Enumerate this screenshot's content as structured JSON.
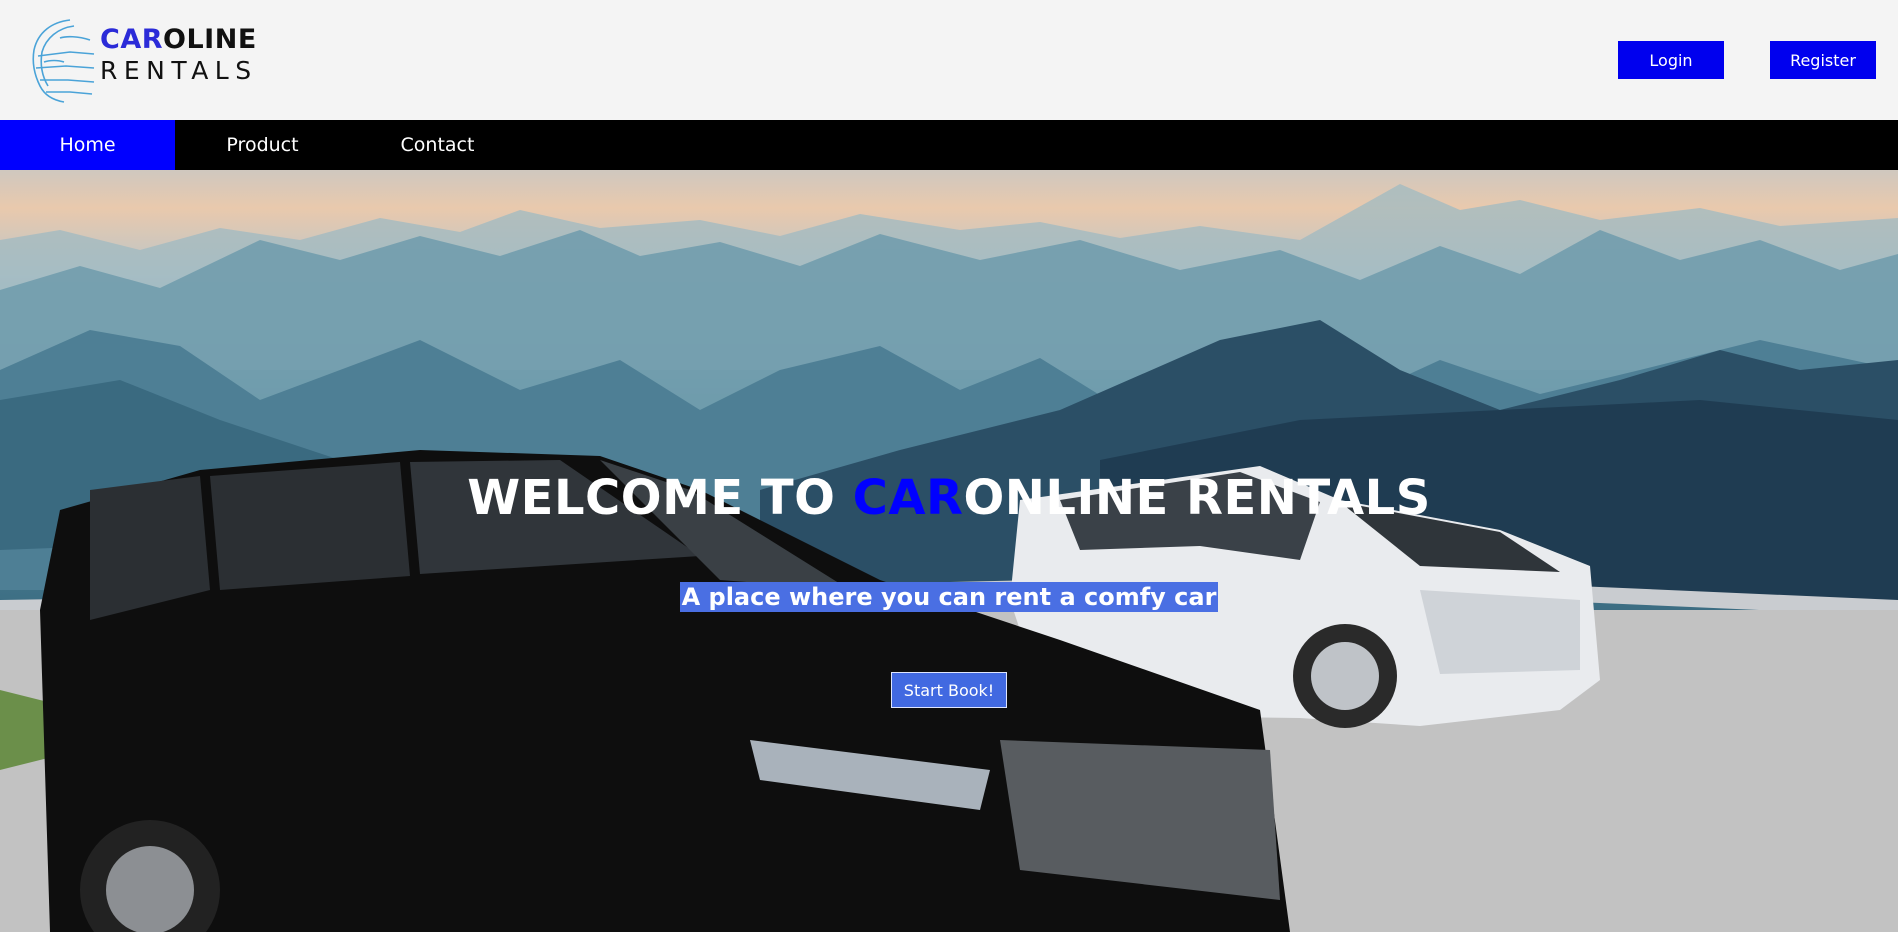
{
  "brand": {
    "logo_accent": "CAR",
    "logo_rest": "OLINE",
    "logo_line2": "RENTALS"
  },
  "header": {
    "login_label": "Login",
    "register_label": "Register"
  },
  "nav": {
    "items": [
      {
        "label": "Home",
        "active": true
      },
      {
        "label": "Product",
        "active": false
      },
      {
        "label": "Contact",
        "active": false
      }
    ]
  },
  "hero": {
    "title_prefix": "WELCOME TO ",
    "title_accent": "CAR",
    "title_suffix": "ONLINE RENTALS",
    "subtitle": "A place where you can rent a comfy car",
    "cta_label": "Start Book!"
  },
  "colors": {
    "primary_blue": "#0000ee",
    "nav_bg": "#000000",
    "header_bg": "#f4f4f4",
    "cta_blue": "#4169e1"
  }
}
